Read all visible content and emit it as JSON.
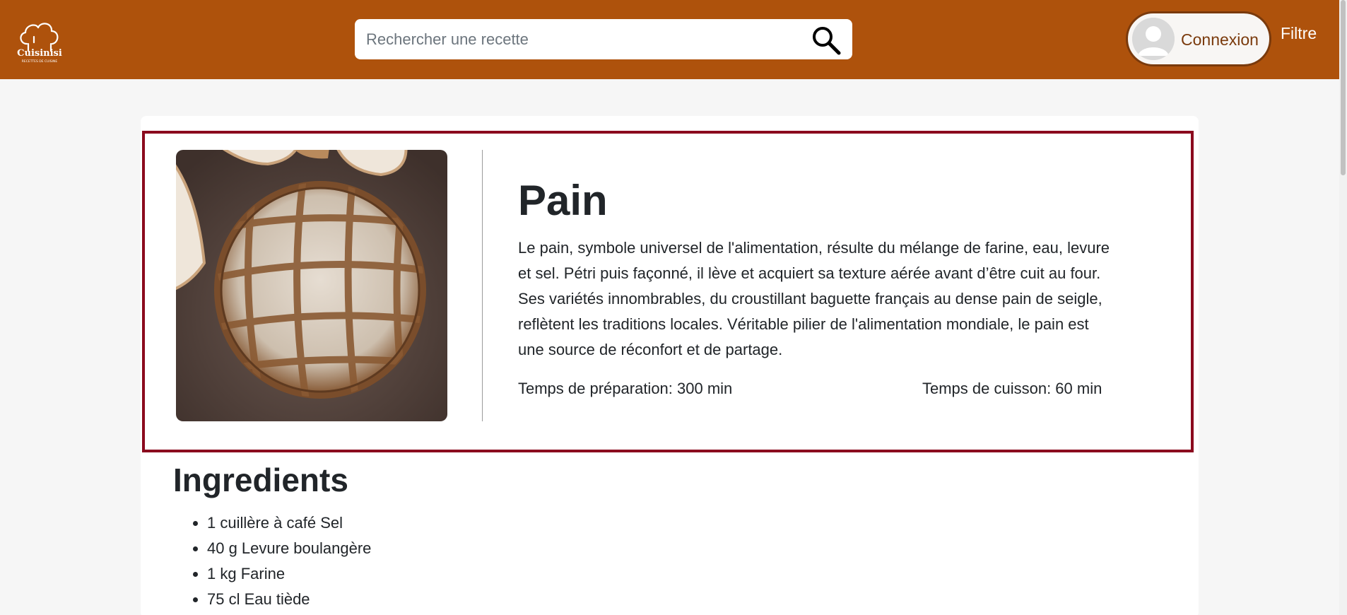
{
  "header": {
    "logo_text": "Cuisinisi",
    "logo_subtext": "RECETTES DE CUISINE",
    "search_placeholder": "Rechercher une recette",
    "search_value": "",
    "login_label": "Connexion",
    "filter_label": "Filtre",
    "colors": {
      "brand": "#ae520c",
      "login_text": "#7a3a0c"
    },
    "icons": {
      "search": "search-icon",
      "avatar": "user-avatar-icon",
      "logo": "chef-hat-icon"
    }
  },
  "recipe": {
    "title": "Pain",
    "description": "Le pain, symbole universel de l'alimentation, résulte du mélange de farine, eau, levure et sel. Pétri puis façonné, il lève et acquiert sa texture aérée avant d’être cuit au four. Ses variétés innombrables, du croustillant baguette français au dense pain de seigle, reflètent les traditions locales. Véritable pilier de l'alimentation mondiale, le pain est une source de réconfort et de partage.",
    "prep_time": "Temps de préparation: 300 min",
    "cook_time": "Temps de cuisson: 60 min",
    "card_border_color": "#8b0a1e"
  },
  "ingredients": {
    "title": "Ingredients",
    "items": [
      "1 cuillère à café Sel",
      "40 g Levure boulangère",
      "1 kg Farine",
      "75 cl Eau tiède"
    ]
  }
}
